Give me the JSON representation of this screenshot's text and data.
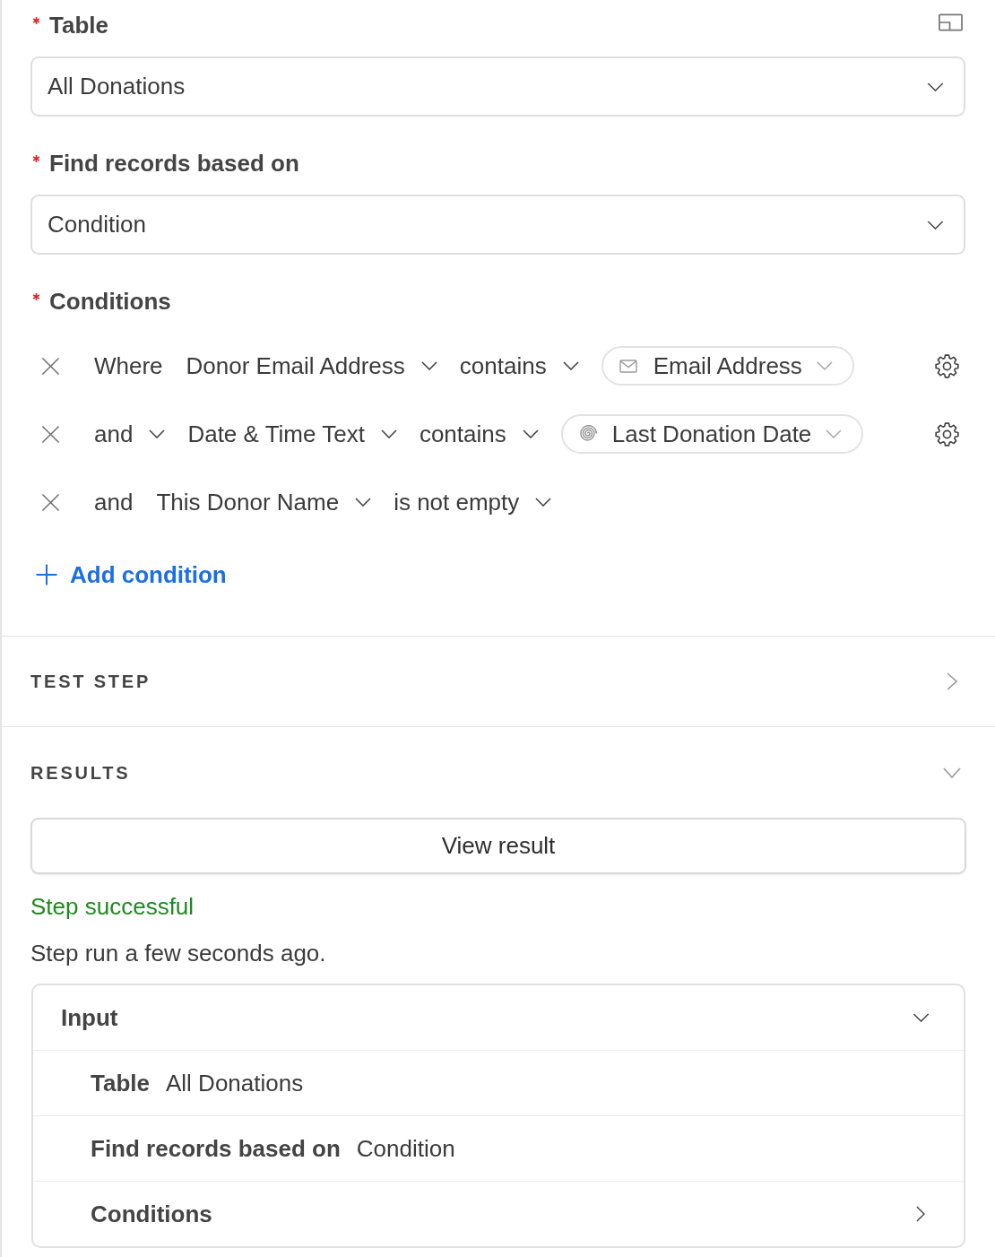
{
  "form": {
    "fields": [
      {
        "label": "Table",
        "required": true,
        "value": "All Donations"
      },
      {
        "label": "Find records based on",
        "required": true,
        "value": "Condition"
      }
    ],
    "conditions": {
      "label": "Conditions",
      "required": true,
      "rows": [
        {
          "connector": {
            "text": "Where",
            "dropdown": false
          },
          "field": "Donor Email Address",
          "operator": "contains",
          "value": {
            "kind": "email",
            "text": "Email Address"
          }
        },
        {
          "connector": {
            "text": "and",
            "dropdown": true
          },
          "field": "Date & Time Text",
          "operator": "contains",
          "value": {
            "kind": "spiral",
            "text": "Last Donation Date"
          }
        },
        {
          "connector": {
            "text": "and",
            "dropdown": false
          },
          "field": "This Donor Name",
          "operator": "is not empty"
        }
      ],
      "add_button": "Add condition"
    }
  },
  "test_step": {
    "title": "TEST STEP",
    "expanded": false
  },
  "results": {
    "title": "RESULTS",
    "expanded": true,
    "view_button": "View result",
    "status": {
      "text": "Step successful",
      "kind": "success"
    },
    "run_info": "Step run a few seconds ago.",
    "input": {
      "title": "Input",
      "expanded": true,
      "rows": [
        {
          "label": "Table",
          "value": "All Donations",
          "expandable": false
        },
        {
          "label": "Find records based on",
          "value": "Condition",
          "expandable": false
        },
        {
          "label": "Conditions",
          "expandable": true
        }
      ]
    }
  }
}
